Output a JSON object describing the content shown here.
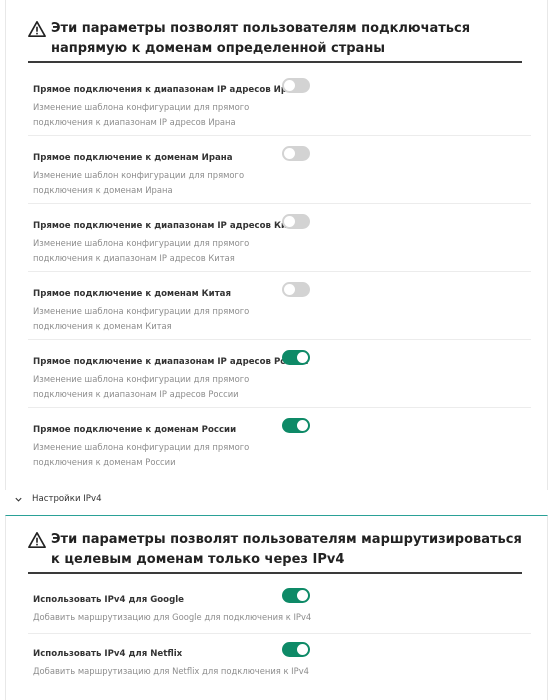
{
  "section_direct": {
    "heading": "Эти параметры позволят пользователям подключаться напрямую к доменам определенной страны",
    "items": [
      {
        "title": "Прямое подключения к диапазонам IP адресов Ирана",
        "description": "Изменение шаблона конфигурации для прямого подключения к диапазонам IP адресов Ирана",
        "enabled": false
      },
      {
        "title": "Прямое подключение к доменам Ирана",
        "description": "Изменение шаблон конфигурации для прямого подключения к доменам Ирана",
        "enabled": false
      },
      {
        "title": "Прямое подключение к диапазонам IP адресов Китая",
        "description": "Изменение шаблона конфигурации для прямого подключения к диапазонам IP адресов Китая",
        "enabled": false
      },
      {
        "title": "Прямое подключение к доменам Китая",
        "description": "Изменение шаблона конфигурации для прямого подключения к доменам Китая",
        "enabled": false
      },
      {
        "title": "Прямое подключение к диапазонам IP адресов России",
        "description": "Изменение шаблона конфигурации для прямого подключения к диапазонам IP адресов России",
        "enabled": true
      },
      {
        "title": "Прямое подключение к доменам России",
        "description": "Изменение шаблона конфигурации для прямого подключения к доменам России",
        "enabled": true
      }
    ]
  },
  "ipv4_toggle_label": "Настройки IPv4",
  "section_ipv4": {
    "heading": "Эти параметры позволят пользователям маршрутизироваться к целевым доменам только через IPv4",
    "items": [
      {
        "title": "Использовать IPv4 для Google",
        "description": "Добавить маршрутизацию для Google для подключения к IPv4",
        "enabled": true
      },
      {
        "title": "Использовать IPv4 для Netflix",
        "description": "Добавить маршрутизацию для Netflix для подключения к IPv4",
        "enabled": true
      }
    ]
  },
  "colors": {
    "accent": "#0e8a67",
    "divider_accent": "#2aa197",
    "toggle_off": "#d3d3d3"
  },
  "icons": {
    "warning": "warning-triangle-icon",
    "collapse": "chevron-down-icon"
  }
}
